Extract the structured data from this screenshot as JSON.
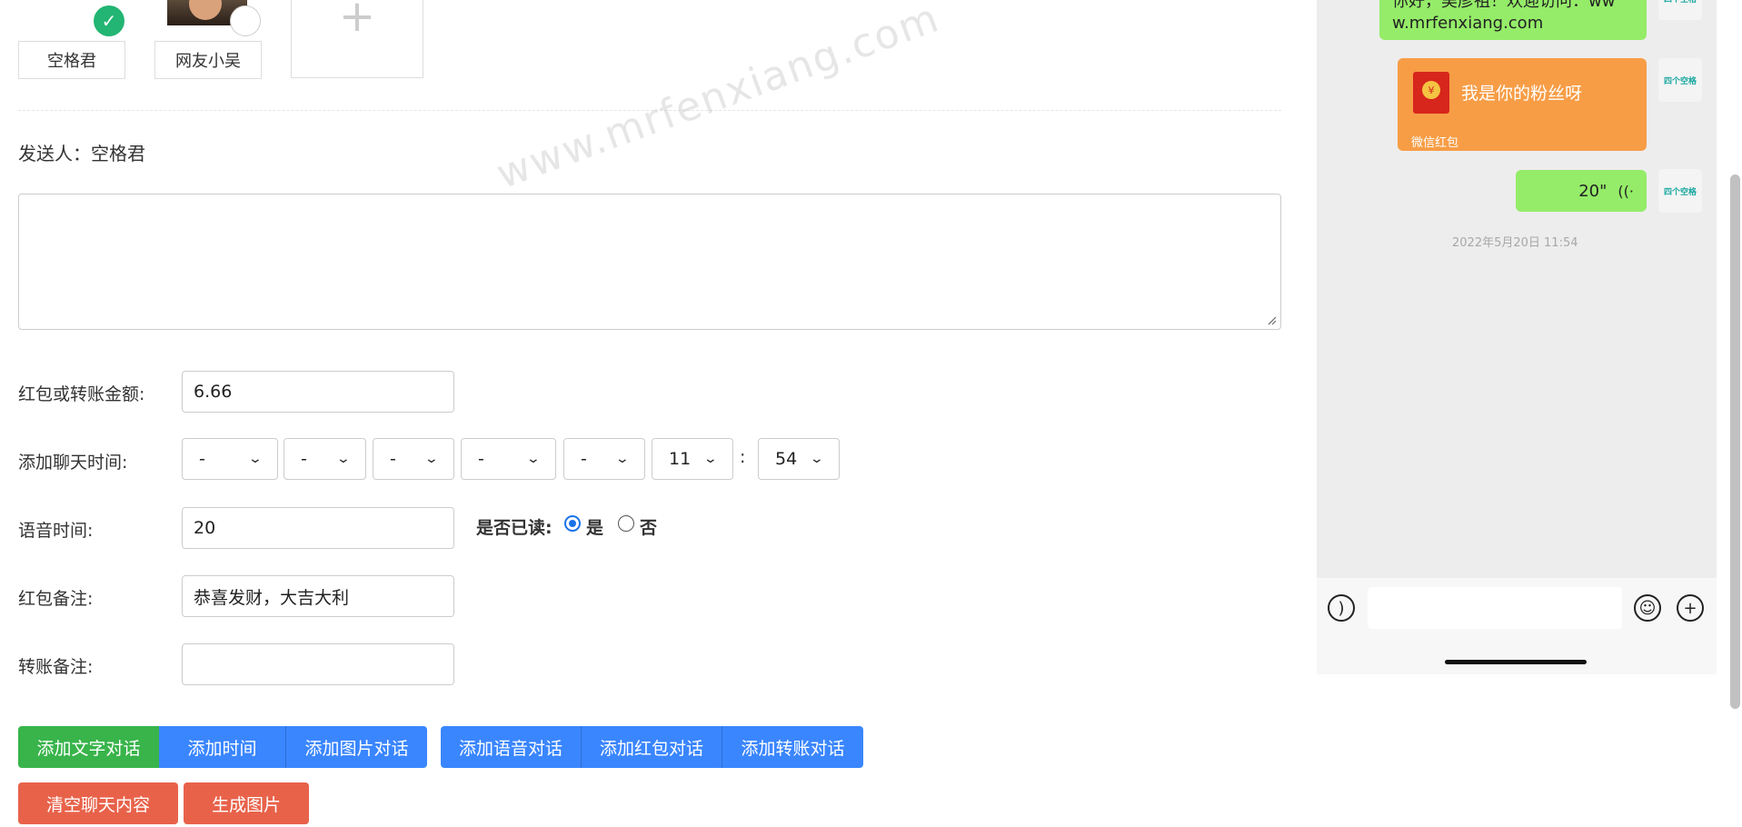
{
  "roles": [
    {
      "name": "空格君",
      "selected": true
    },
    {
      "name": "网友小吴",
      "selected": false
    }
  ],
  "add_role_symbol": "+",
  "sender": {
    "label": "发送人：",
    "name": "空格君"
  },
  "content": {
    "value": ""
  },
  "amount": {
    "label": "红包或转账金额:",
    "value": "6.66"
  },
  "chat_time": {
    "label": "添加聊天时间:",
    "year": "-",
    "month": "-",
    "day": "-",
    "weekday": "-",
    "period": "-",
    "hour": "11",
    "separator": ":",
    "minute": "54"
  },
  "voice": {
    "label": "语音时间:",
    "value": "20"
  },
  "read_status": {
    "label": "是否已读:",
    "yes": "是",
    "no": "否",
    "selected": "是"
  },
  "redpacket_note": {
    "label": "红包备注:",
    "value": "恭喜发财，大吉大利"
  },
  "transfer_note": {
    "label": "转账备注:",
    "value": ""
  },
  "buttons": {
    "add_text": "添加文字对话",
    "add_time": "添加时间",
    "add_image": "添加图片对话",
    "add_voice": "添加语音对话",
    "add_redpacket": "添加红包对话",
    "add_transfer": "添加转账对话",
    "clear": "清空聊天内容",
    "generate": "生成图片"
  },
  "watermark": "www.mrfenxiang.com",
  "phone": {
    "msg_text_line1": "你好，吴彦祖！欢迎访问：ww",
    "msg_text_line2": "w.mrfenxiang.com",
    "avatar_label": "四个空格",
    "redpacket_title": "我是你的粉丝呀",
    "redpacket_footer": "微信红包",
    "voice_duration": "20\"",
    "timestamp": "2022年5月20日 11:54"
  },
  "colors": {
    "green": "#38b44a",
    "blue": "#3a86ff",
    "red": "#e8624a",
    "bubble_green": "#95ec69",
    "redpacket_orange": "#f79d46"
  }
}
